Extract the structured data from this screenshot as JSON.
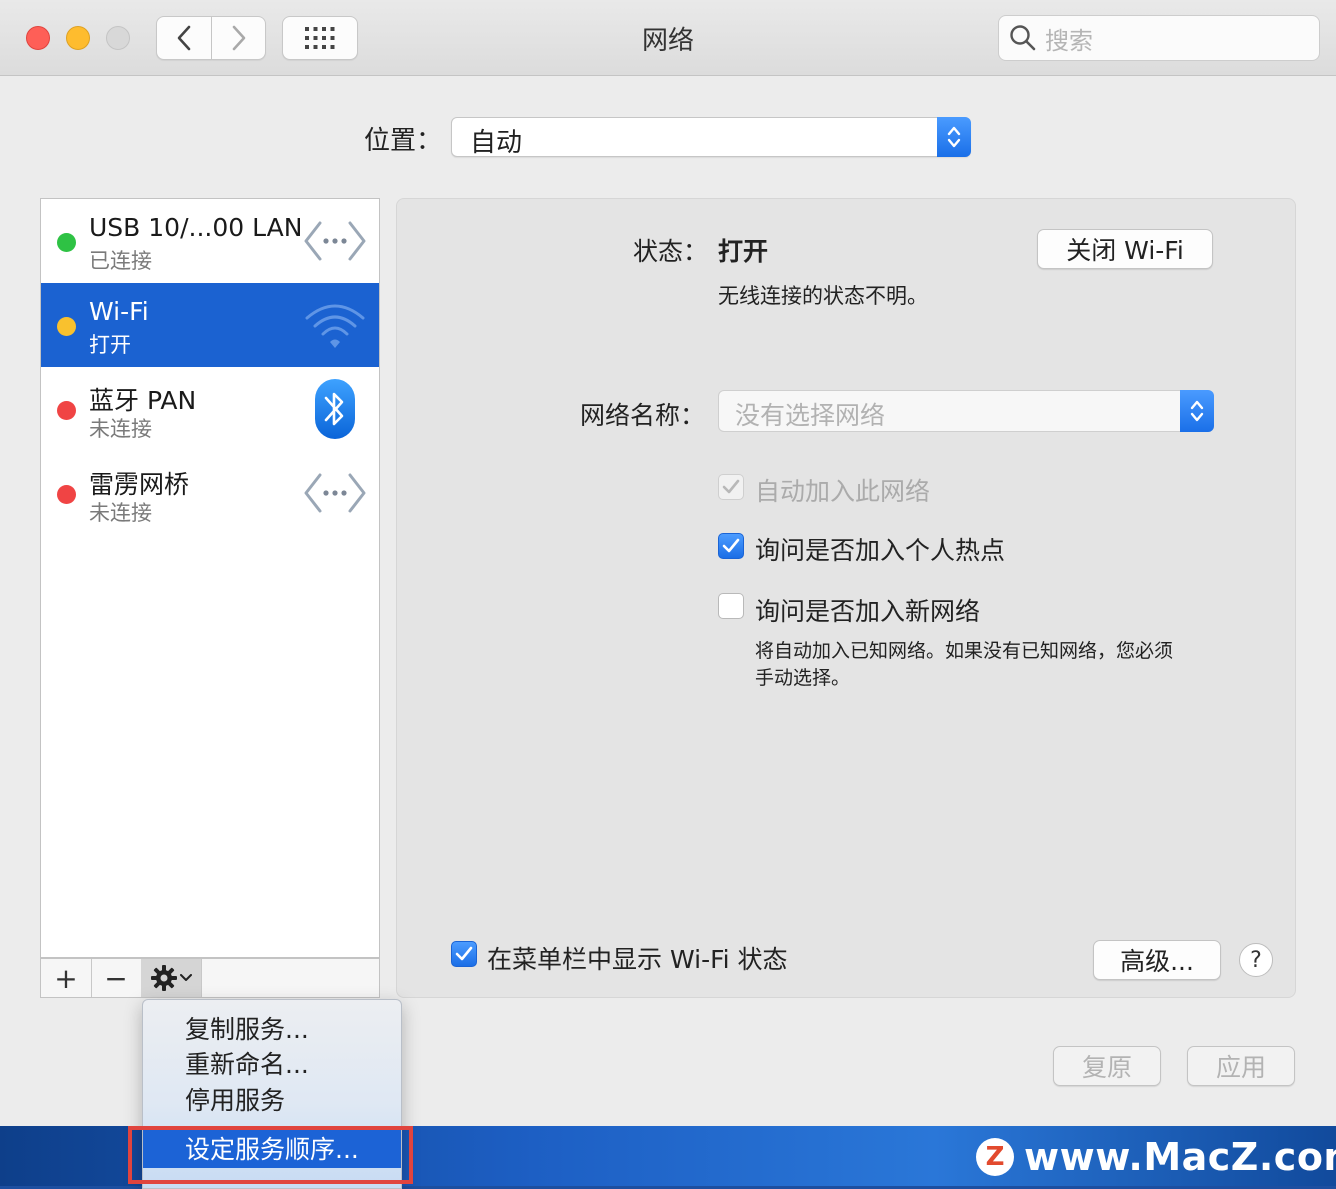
{
  "window": {
    "title": "网络",
    "search_placeholder": "搜索"
  },
  "location": {
    "label": "位置：",
    "value": "自动"
  },
  "services": [
    {
      "name": "USB 10/...00 LAN",
      "status": "已连接",
      "dot_color": "#2ec244",
      "icon": "ethernet-icon"
    },
    {
      "name": "Wi-Fi",
      "status": "打开",
      "dot_color": "#f9c12e",
      "icon": "wifi-icon"
    },
    {
      "name": "蓝牙 PAN",
      "status": "未连接",
      "dot_color": "#f04444",
      "icon": "bluetooth-icon"
    },
    {
      "name": "雷雳网桥",
      "status": "未连接",
      "dot_color": "#f04444",
      "icon": "thunderbolt-bridge-icon"
    }
  ],
  "sidebar_toolbar": {
    "add": "+",
    "remove": "−"
  },
  "detail": {
    "status_label": "状态：",
    "status_value": "打开",
    "turn_off_button": "关闭 Wi-Fi",
    "status_desc": "无线连接的状态不明。",
    "network_name_label": "网络名称：",
    "network_name_placeholder": "没有选择网络",
    "auto_join_label": "自动加入此网络",
    "ask_hotspot_label": "询问是否加入个人热点",
    "ask_new_label": "询问是否加入新网络",
    "ask_new_desc_line1": "将自动加入已知网络。如果没有已知网络，您必须",
    "ask_new_desc_line2": "手动选择。",
    "show_menubar_label": "在菜单栏中显示 Wi-Fi 状态",
    "advanced_button": "高级...",
    "help": "?"
  },
  "footer": {
    "revert": "复原",
    "apply": "应用"
  },
  "menu": {
    "items": [
      "复制服务...",
      "重新命名...",
      "停用服务"
    ],
    "highlighted": "设定服务顺序..."
  },
  "watermark": {
    "logo": "Z",
    "text": "www.MacZ.com"
  },
  "colors": {
    "accent": "#1b62d1",
    "selection": "#1b62d1",
    "highlight_border": "#e0443e"
  }
}
